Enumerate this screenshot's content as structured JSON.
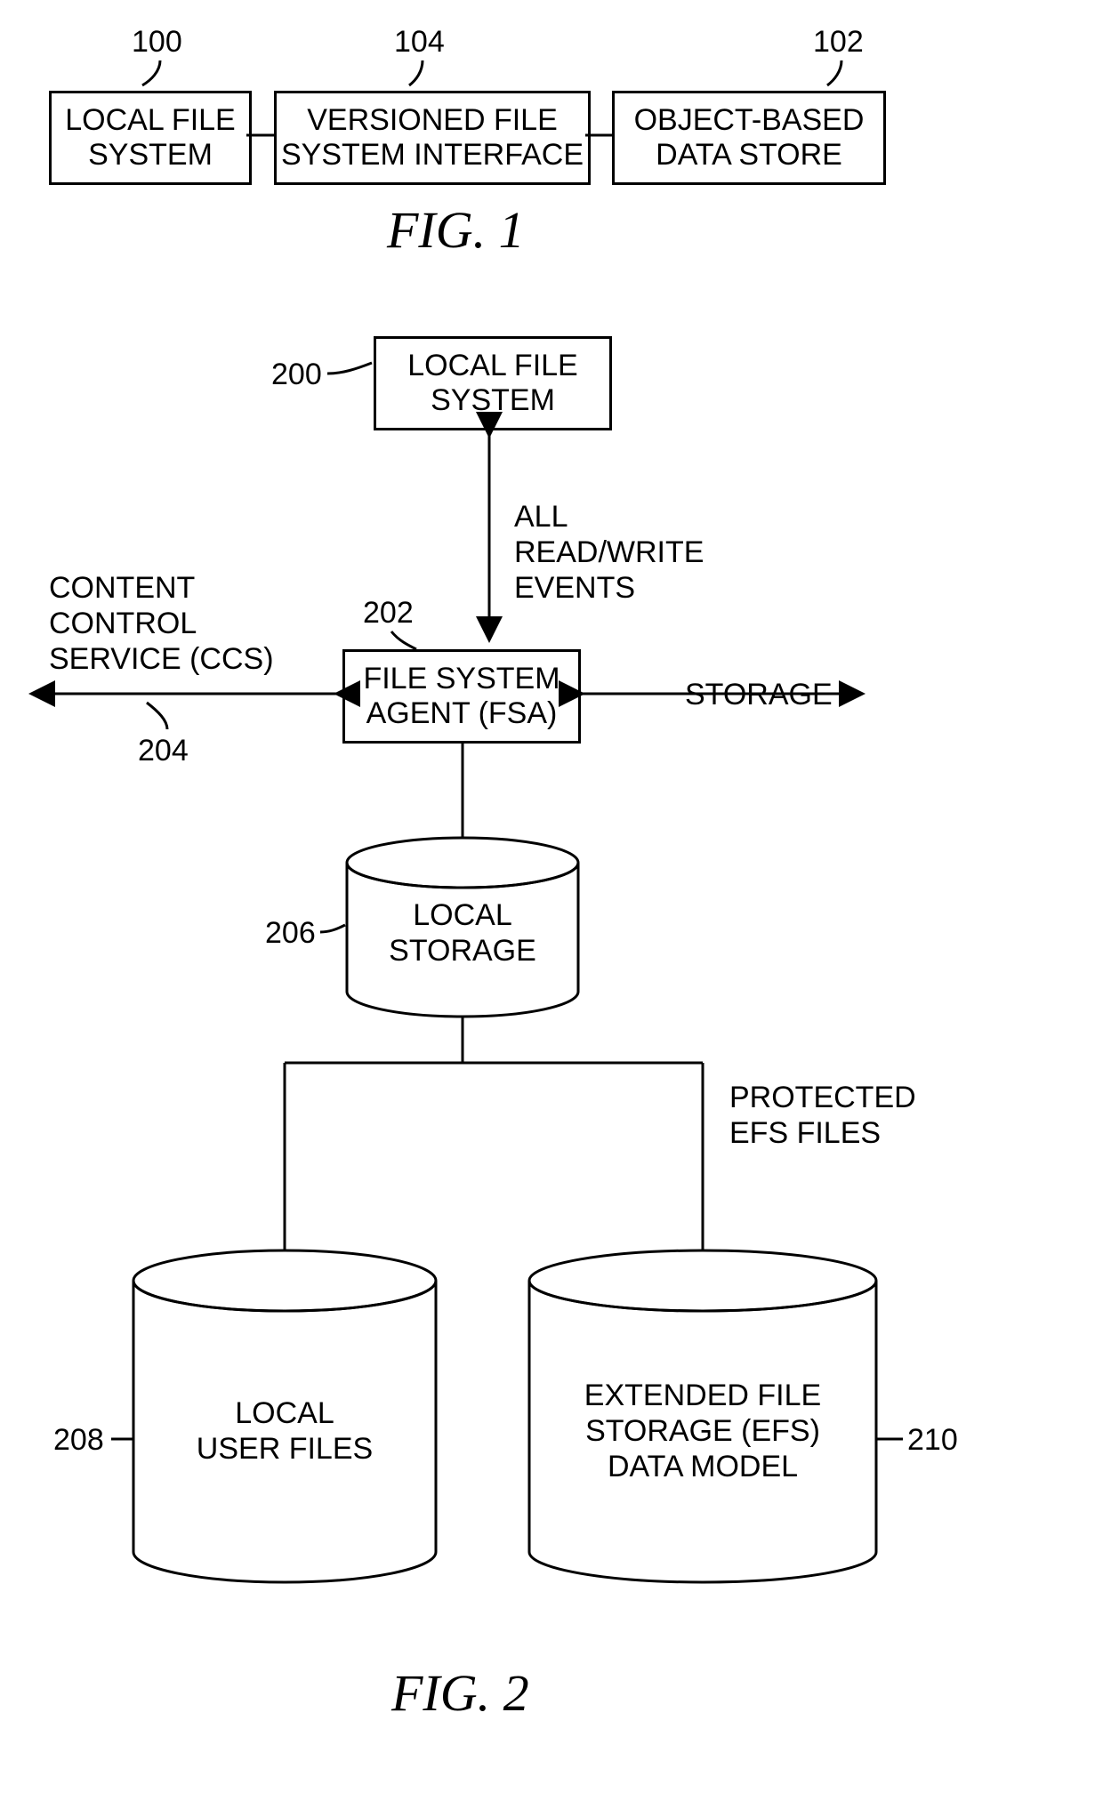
{
  "fig1": {
    "caption": "FIG. 1",
    "labels": {
      "b100": "100",
      "b104": "104",
      "b102": "102"
    },
    "boxes": {
      "b100": [
        "LOCAL FILE",
        "SYSTEM"
      ],
      "b104": [
        "VERSIONED FILE",
        "SYSTEM INTERFACE"
      ],
      "b102": [
        "OBJECT-BASED",
        "DATA STORE"
      ]
    }
  },
  "fig2": {
    "caption": "FIG. 2",
    "labels": {
      "b200": "200",
      "b202": "202",
      "b204": "204",
      "b206": "206",
      "b208": "208",
      "b210": "210"
    },
    "text": {
      "allEventsL1": "ALL",
      "allEventsL2": "READ/WRITE",
      "allEventsL3": "EVENTS",
      "ccsL1": "CONTENT",
      "ccsL2": "CONTROL",
      "ccsL3": "SERVICE (CCS)",
      "storage": "STORAGE",
      "protL1": "PROTECTED",
      "protL2": "EFS FILES"
    },
    "boxes": {
      "b200": [
        "LOCAL FILE",
        "SYSTEM"
      ],
      "b202": [
        "FILE SYSTEM",
        "AGENT (FSA)"
      ]
    },
    "cylinders": {
      "c206": [
        "LOCAL",
        "STORAGE"
      ],
      "c208": [
        "LOCAL",
        "USER FILES"
      ],
      "c210": [
        "EXTENDED FILE",
        "STORAGE (EFS)",
        "DATA MODEL"
      ]
    }
  }
}
